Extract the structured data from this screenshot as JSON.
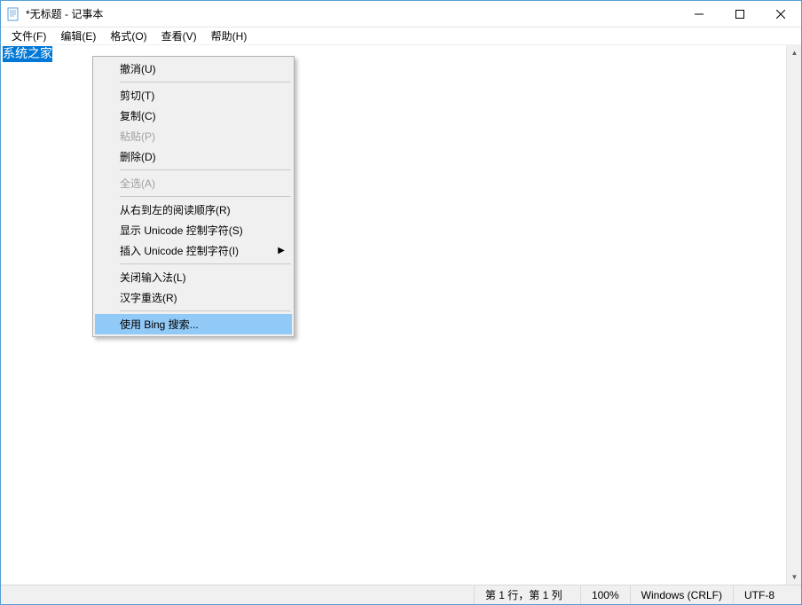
{
  "window": {
    "title": "*无标题 - 记事本"
  },
  "menubar": {
    "file": "文件(F)",
    "edit": "编辑(E)",
    "format": "格式(O)",
    "view": "查看(V)",
    "help": "帮助(H)"
  },
  "editor": {
    "selected_text": "系统之家"
  },
  "context_menu": {
    "undo": "撤消(U)",
    "cut": "剪切(T)",
    "copy": "复制(C)",
    "paste": "粘贴(P)",
    "delete": "删除(D)",
    "select_all": "全选(A)",
    "rtl_reading": "从右到左的阅读顺序(R)",
    "show_unicode": "显示 Unicode 控制字符(S)",
    "insert_unicode": "插入 Unicode 控制字符(I)",
    "close_ime": "关闭输入法(L)",
    "hanzi_reselect": "汉字重选(R)",
    "bing_search": "使用 Bing 搜索..."
  },
  "statusbar": {
    "position": "第 1 行，第 1 列",
    "zoom": "100%",
    "line_ending": "Windows (CRLF)",
    "encoding": "UTF-8"
  }
}
